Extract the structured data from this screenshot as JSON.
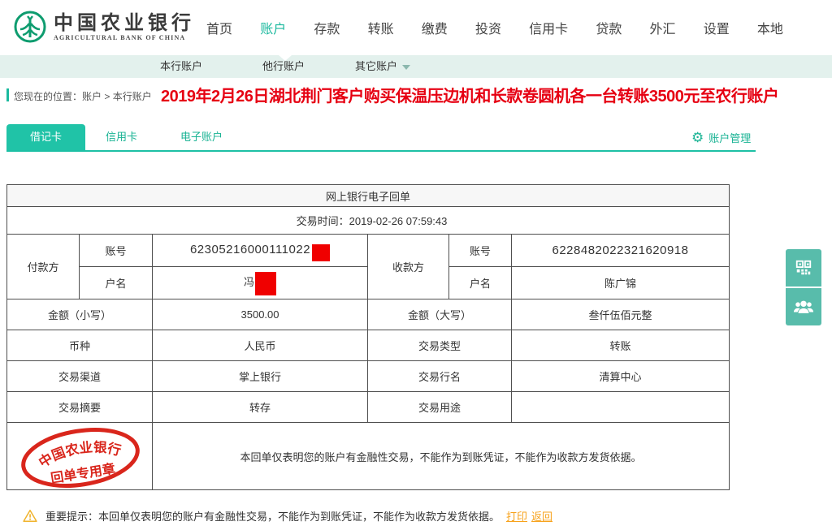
{
  "brand": {
    "cn": "中国农业银行",
    "en": "AGRICULTURAL BANK OF CHINA"
  },
  "nav": {
    "items": [
      "首页",
      "账户",
      "存款",
      "转账",
      "缴费",
      "投资",
      "信用卡",
      "贷款",
      "外汇",
      "设置",
      "本地"
    ],
    "active": "账户"
  },
  "subnav": {
    "items": [
      "本行账户",
      "他行账户",
      "其它账户"
    ]
  },
  "breadcrumb": {
    "prefix": "您现在的位置：",
    "path": "账户 > 本行账户"
  },
  "annotation": {
    "text": "2019年2月26日湖北荆门客户购买保温压边机和长款卷圆机各一台转账3500元至农行账户",
    "color": "#e60012"
  },
  "tabs": {
    "debit": "借记卡",
    "credit": "信用卡",
    "e_account": "电子账户",
    "manage": "账户管理"
  },
  "receipt": {
    "title": "网上银行电子回单",
    "time_label": "交易时间：",
    "time": "2019-02-26 07:59:43",
    "payer_label": "付款方",
    "payee_label": "收款方",
    "account_label": "账号",
    "name_label": "户名",
    "payer_account": "62305216000111022",
    "payer_name": "冯",
    "payee_account": "6228482022321620918",
    "payee_name": "陈广锦",
    "amount_small_label": "金额（小写）",
    "amount_small": "3500.00",
    "amount_big_label": "金额（大写）",
    "amount_big": "叁仟伍佰元整",
    "currency_label": "币种",
    "currency": "人民币",
    "type_label": "交易类型",
    "type": "转账",
    "channel_label": "交易渠道",
    "channel": "掌上银行",
    "bank_label": "交易行名",
    "bank": "清算中心",
    "summary_label": "交易摘要",
    "summary": "转存",
    "purpose_label": "交易用途",
    "purpose": "",
    "disclaimer": "本回单仅表明您的账户有金融性交易，不能作为到账凭证，不能作为收款方发货依据。"
  },
  "stamp": {
    "line1": "中国农业银行",
    "line2": "回单专用章",
    "color": "#d9261c"
  },
  "footer": {
    "notice": "重要提示：本回单仅表明您的账户有金融性交易，不能作为到账凭证，不能作为收款方发货依据。",
    "print": "打印",
    "back": "返回"
  },
  "icons": {
    "logo": "abc-bank-logo",
    "gear": "gear-icon",
    "dropdown": "chevron-down-icon",
    "qr": "qr-code-icon",
    "people": "contacts-icon",
    "warning": "warning-icon"
  },
  "colors": {
    "accent_teal": "#1ab394",
    "tab_active": "#20c3a7",
    "subnav_bg": "#e3f1ed",
    "logo_green": "#0e9c6f",
    "link_orange": "#f7a21b",
    "redact_red": "#f00000",
    "stamp_red": "#d9261c",
    "table_border": "#4f4f4f"
  }
}
